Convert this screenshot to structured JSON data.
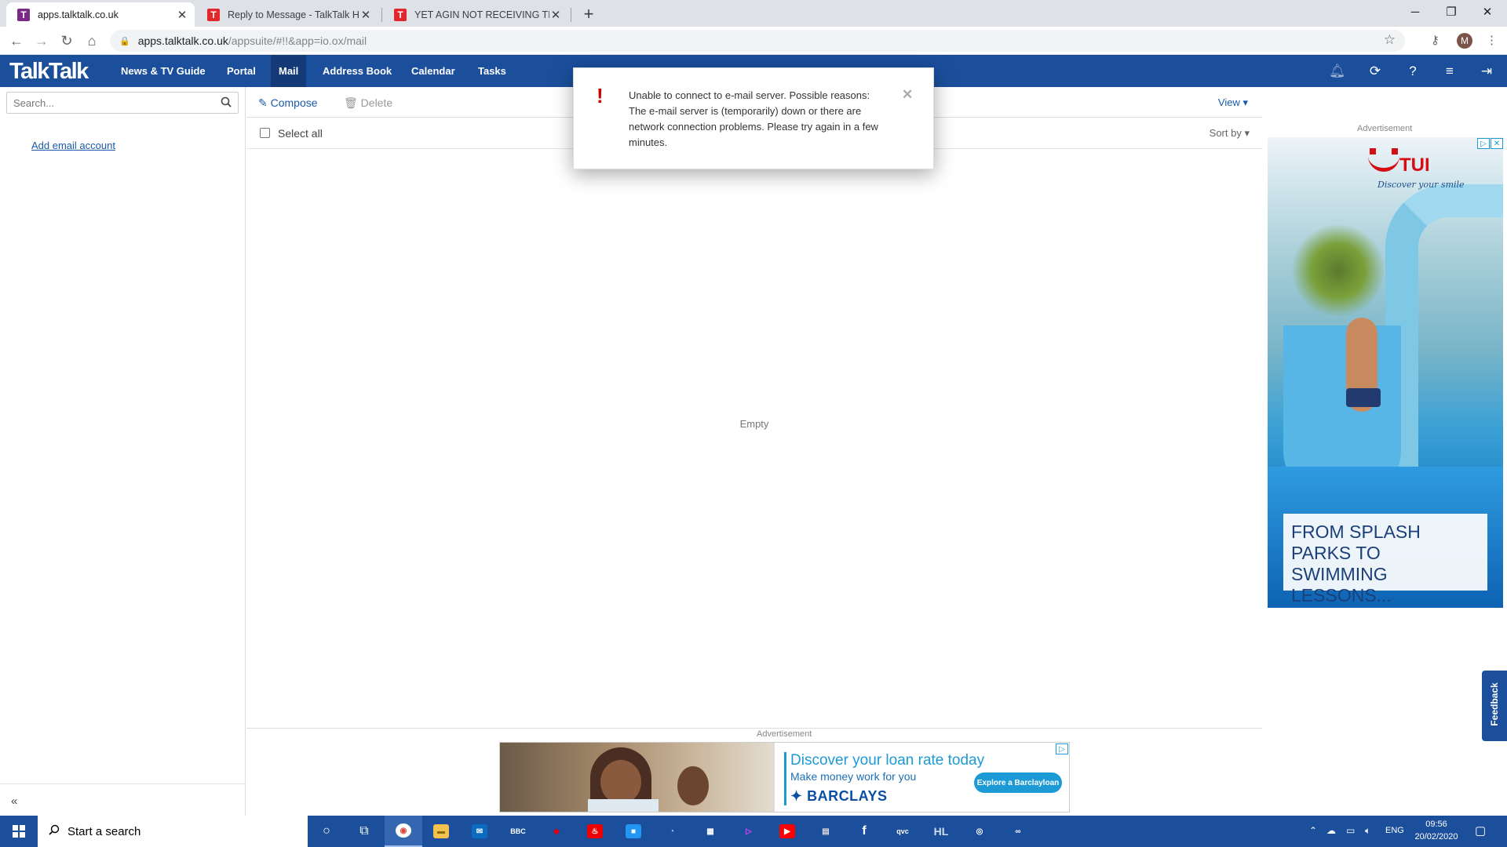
{
  "browser": {
    "tabs": [
      {
        "title": "apps.talktalk.co.uk",
        "favicon": "T",
        "favicon_color": "#7a2a86",
        "active": true
      },
      {
        "title": "Reply to Message - TalkTalk Help",
        "favicon": "T",
        "favicon_color": "#e3262b",
        "active": false
      },
      {
        "title": "YET AGIN NOT RECEIVING TISCA",
        "favicon": "T",
        "favicon_color": "#e3262b",
        "active": false
      }
    ],
    "url_host": "apps.talktalk.co.uk",
    "url_path": "/appsuite/#!!&app=io.ox/mail",
    "profile_initial": "M"
  },
  "app": {
    "logo": "TalkTalk",
    "nav": [
      {
        "label": "News & TV Guide"
      },
      {
        "label": "Portal"
      },
      {
        "label": "Mail",
        "active": true
      },
      {
        "label": "Address Book"
      },
      {
        "label": "Calendar"
      },
      {
        "label": "Tasks"
      }
    ],
    "top_icons": [
      "bell-icon",
      "refresh-icon",
      "help-icon",
      "menu-icon",
      "logout-icon"
    ],
    "accent_color": "#1b4f9c"
  },
  "sidebar": {
    "search_placeholder": "Search...",
    "add_account": "Add email account",
    "collapse": "«"
  },
  "mail": {
    "compose": "Compose",
    "delete": "Delete",
    "view": "View",
    "select_all": "Select all",
    "sort_by": "Sort by",
    "empty": "Empty"
  },
  "error_dialog": {
    "icon": "!",
    "message": "Unable to connect to e-mail server. Possible reasons: The e-mail server is (temporarily) down or there are network connection problems. Please try again in a few minutes."
  },
  "ads": {
    "right_label": "Advertisement",
    "right_brand": "TUI",
    "right_tagline": "Discover your smile",
    "right_headline": "FROM SPLASH PARKS TO SWIMMING LESSONS...",
    "bottom_label": "Advertisement",
    "bottom_headline": "Discover your loan rate today",
    "bottom_sub": "Make money work for you",
    "bottom_brand": "BARCLAYS",
    "bottom_cta": "Explore a Barclayloan"
  },
  "feedback": "Feedback",
  "taskbar": {
    "search_placeholder": "Start a search",
    "language": "ENG",
    "time": "09:56",
    "date": "20/02/2020"
  }
}
